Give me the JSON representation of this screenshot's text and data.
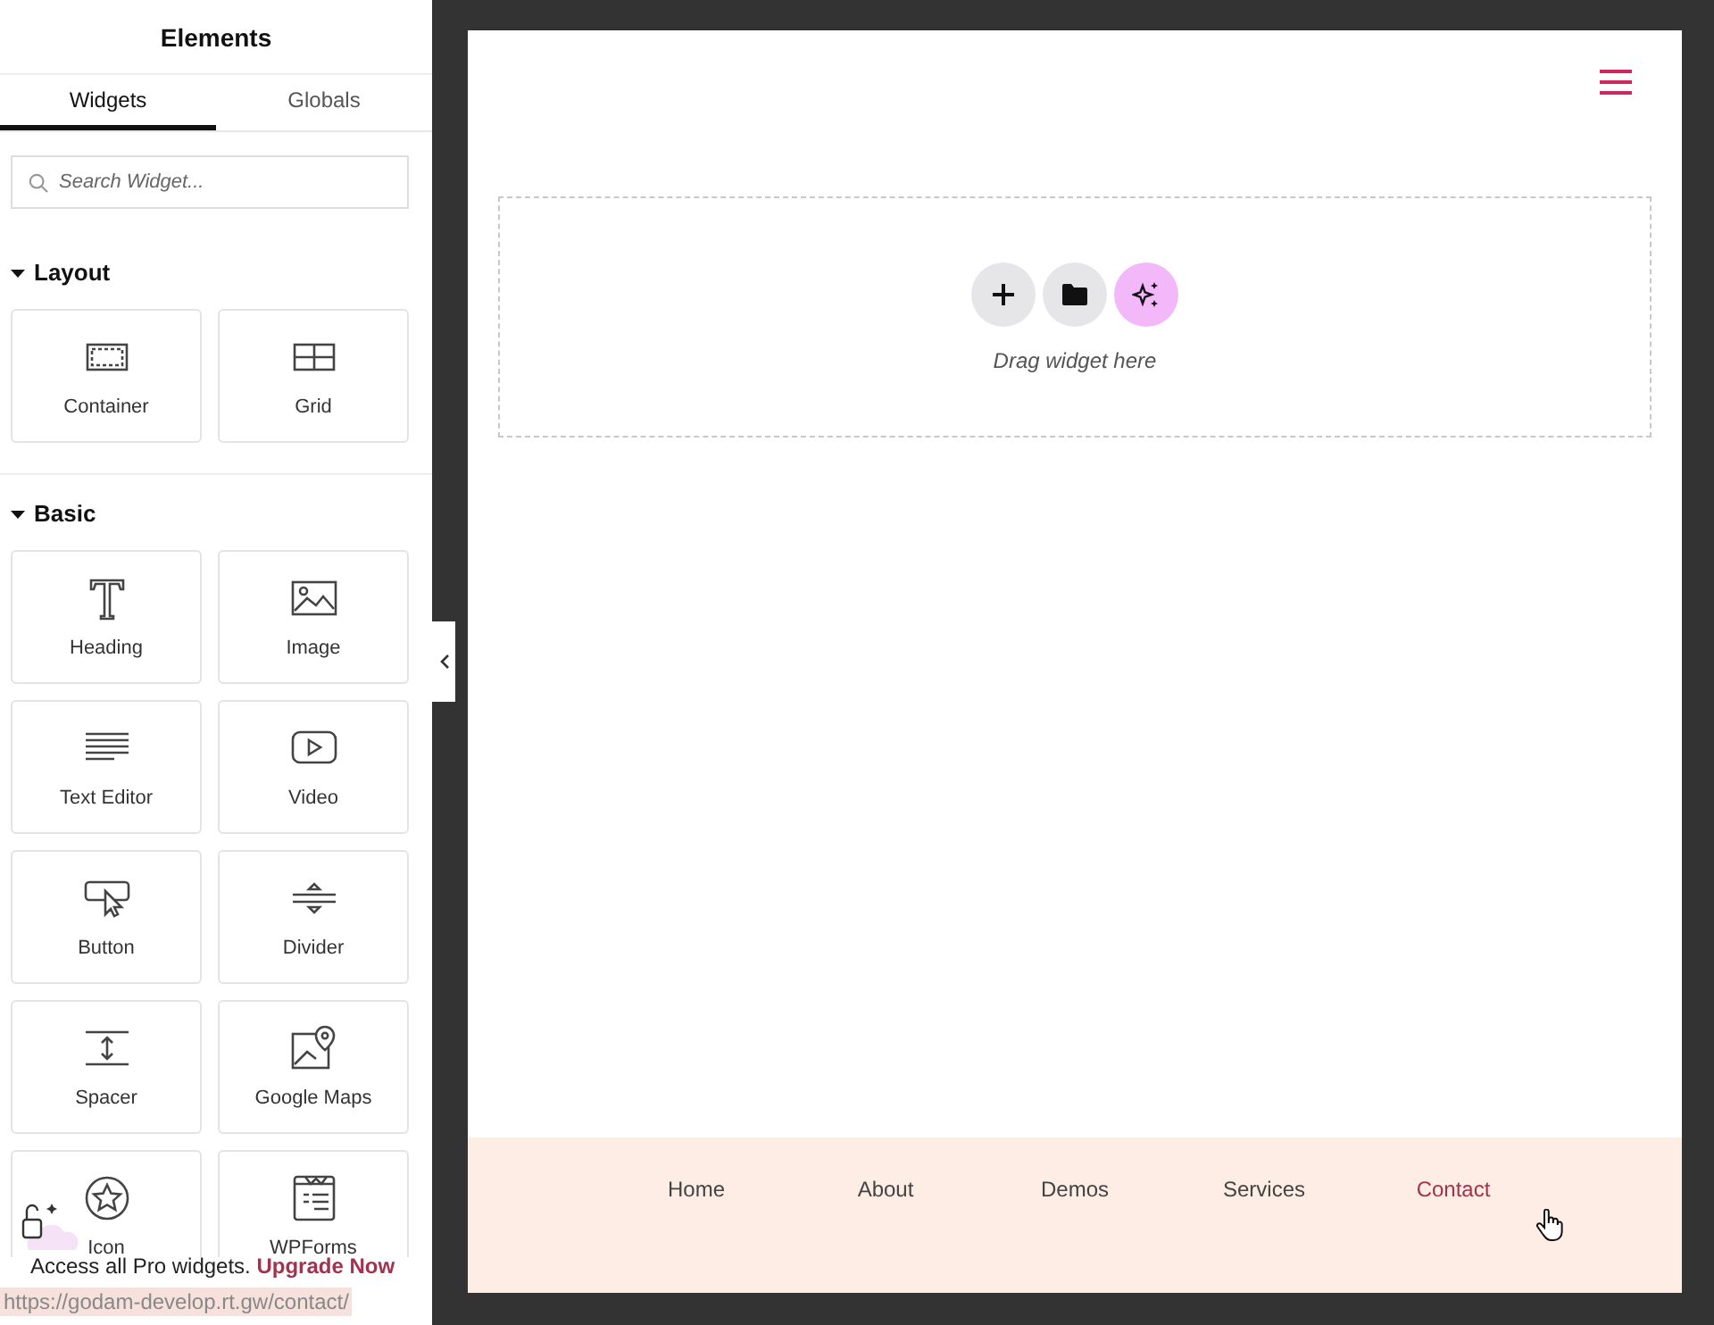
{
  "panel": {
    "title": "Elements",
    "tabs": [
      {
        "label": "Widgets",
        "selected": true
      },
      {
        "label": "Globals",
        "selected": false
      }
    ],
    "search": {
      "placeholder": "Search Widget..."
    },
    "categories": [
      {
        "title": "Layout",
        "expanded": true,
        "widgets": [
          {
            "label": "Container",
            "kind": "container"
          },
          {
            "label": "Grid",
            "kind": "grid"
          }
        ]
      },
      {
        "title": "Basic",
        "expanded": true,
        "widgets": [
          {
            "label": "Heading",
            "kind": "heading"
          },
          {
            "label": "Image",
            "kind": "image"
          },
          {
            "label": "Text Editor",
            "kind": "text"
          },
          {
            "label": "Video",
            "kind": "video"
          },
          {
            "label": "Button",
            "kind": "button"
          },
          {
            "label": "Divider",
            "kind": "divider"
          },
          {
            "label": "Spacer",
            "kind": "spacer"
          },
          {
            "label": "Google Maps",
            "kind": "map"
          },
          {
            "label": "Icon",
            "kind": "star"
          },
          {
            "label": "WPForms",
            "kind": "form"
          }
        ]
      }
    ],
    "promo": {
      "text": "Access all Pro widgets.",
      "link": "Upgrade Now"
    },
    "status_url": "https://godam-develop.rt.gw/contact/"
  },
  "canvas": {
    "drop_zone": {
      "hint": "Drag widget here"
    },
    "footer_nav": [
      {
        "label": "Home",
        "selected": false
      },
      {
        "label": "About",
        "selected": false
      },
      {
        "label": "Demos",
        "selected": false
      },
      {
        "label": "Services",
        "selected": false
      },
      {
        "label": "Contact",
        "selected": true
      }
    ]
  }
}
